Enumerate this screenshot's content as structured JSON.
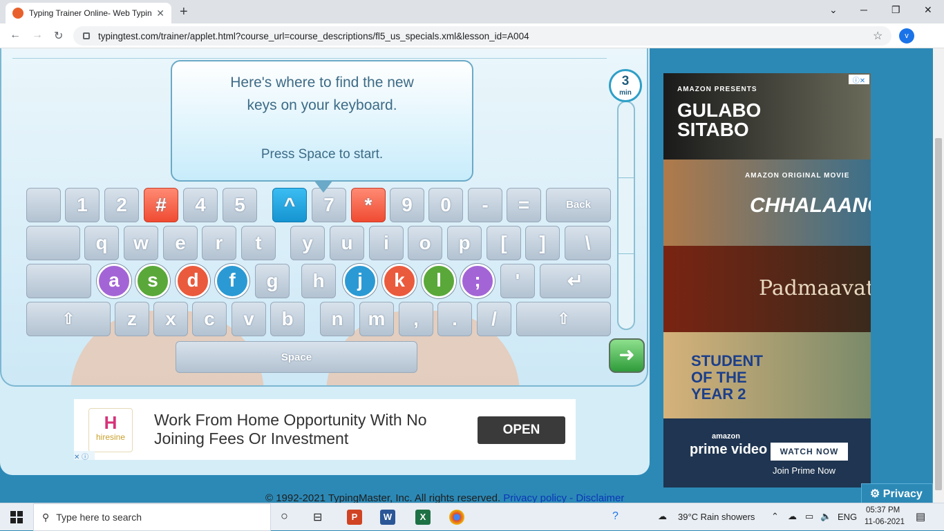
{
  "browser": {
    "tab_title": "Typing Trainer Online- Web Typin",
    "url": "typingtest.com/trainer/applet.html?course_url=course_descriptions/fl5_us_specials.xml&lesson_id=A004",
    "profile_initial": "v"
  },
  "trainer": {
    "bubble": {
      "line1": "Here's where to find the new",
      "line2": "keys on your keyboard.",
      "line3": "Press Space to start."
    },
    "timer": {
      "value": "3",
      "unit": "min"
    },
    "keyboard": {
      "row1": [
        "",
        "1",
        "2",
        "#",
        "4",
        "5",
        "^",
        "7",
        "*",
        "9",
        "0",
        "-",
        "=",
        "Back"
      ],
      "row2": [
        "",
        "q",
        "w",
        "e",
        "r",
        "t",
        "y",
        "u",
        "i",
        "o",
        "p",
        "[",
        "]",
        "\\"
      ],
      "row3": [
        "",
        "a",
        "s",
        "d",
        "f",
        "g",
        "h",
        "j",
        "k",
        "l",
        ";",
        "'",
        "↵"
      ],
      "row4": [
        "⇧",
        "z",
        "x",
        "c",
        "v",
        "b",
        "n",
        "m",
        ",",
        ".",
        "/",
        "⇧"
      ],
      "space": "Space"
    },
    "next_arrow": "➜"
  },
  "ad_banner": {
    "brand": "hiresine",
    "headline": "Work From Home Opportunity With No Joining Fees Or Investment",
    "cta": "OPEN"
  },
  "footer": {
    "copyright": "© 1992-2021 TypingMaster, Inc. All rights reserved.",
    "privacy_link": "Privacy policy",
    "separator": " - ",
    "disclaimer_link": "Disclaimer"
  },
  "side_ad": {
    "p1_top": "AMAZON PRESENTS",
    "p1_title": "GULABO SITABO",
    "p2_top": "AMAZON ORIGINAL MOVIE",
    "p2_title": "CHHALAANG",
    "p3_title": "Padmaavat",
    "p4_title": "STUDENT OF THE YEAR 2",
    "p5_brand": "amazon",
    "p5_title": "prime video",
    "p5_cta": "WATCH NOW",
    "p5_join": "Join Prime Now"
  },
  "privacy_button": "Privacy",
  "taskbar": {
    "search_placeholder": "Type here to search",
    "weather": "39°C  Rain showers",
    "lang": "ENG",
    "time": "05:37 PM",
    "date": "11-06-2021"
  },
  "colors": {
    "page_bg": "#2c89b6",
    "red_key": "#ef4b32",
    "blue_key": "#1594d1"
  }
}
